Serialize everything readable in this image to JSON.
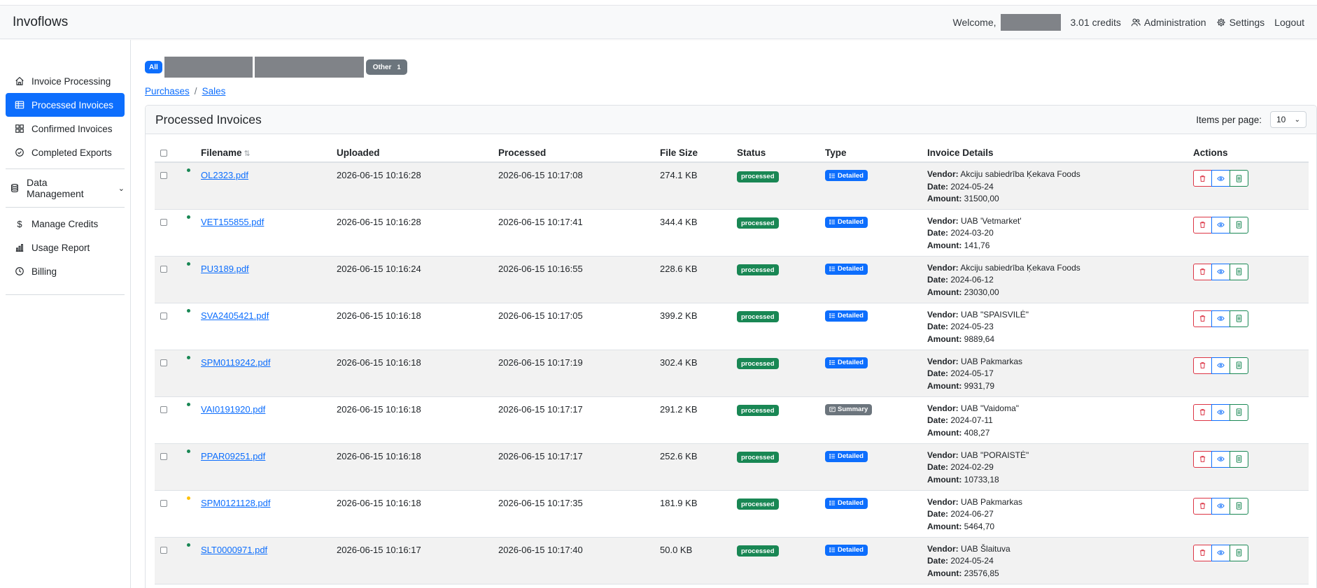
{
  "app": {
    "title": "Invoflows"
  },
  "header": {
    "welcome": "Welcome,",
    "credits": "3.01 credits",
    "administration": "Administration",
    "settings": "Settings",
    "logout": "Logout"
  },
  "sidebar": {
    "items": [
      {
        "label": "Invoice Processing",
        "icon": "home-icon",
        "active": false
      },
      {
        "label": "Processed Invoices",
        "icon": "table-icon",
        "active": true
      },
      {
        "label": "Confirmed Invoices",
        "icon": "grid-icon",
        "active": false
      },
      {
        "label": "Completed Exports",
        "icon": "check-circle-icon",
        "active": false
      }
    ],
    "data_management": "Data Management",
    "bottom_items": [
      {
        "label": "Manage Credits",
        "icon": "dollar-icon"
      },
      {
        "label": "Usage Report",
        "icon": "bar-chart-icon"
      },
      {
        "label": "Billing",
        "icon": "clock-icon"
      }
    ]
  },
  "filters": {
    "all": "All",
    "other": "Other",
    "other_count": "1"
  },
  "breadcrumb": {
    "purchases": "Purchases",
    "separator": "/",
    "sales": "Sales"
  },
  "card": {
    "title": "Processed Invoices",
    "items_per_page_label": "Items per page:",
    "items_per_page_value": "10"
  },
  "table": {
    "columns": [
      "Filename",
      "Uploaded",
      "Processed",
      "File Size",
      "Status",
      "Type",
      "Invoice Details",
      "Actions"
    ],
    "details_labels": {
      "vendor": "Vendor:",
      "date": "Date:",
      "amount": "Amount:"
    },
    "rows": [
      {
        "filename": "OL2323.pdf",
        "uploaded": "2026-06-15 10:16:28",
        "processed": "2026-06-15 10:17:08",
        "size": "274.1 KB",
        "status": "processed",
        "type": "Detailed",
        "dot": "ok",
        "vendor": "Akciju sabiedrība Ķekava Foods",
        "date": "2024-05-24",
        "amount": "31500,00"
      },
      {
        "filename": "VET155855.pdf",
        "uploaded": "2026-06-15 10:16:28",
        "processed": "2026-06-15 10:17:41",
        "size": "344.4 KB",
        "status": "processed",
        "type": "Detailed",
        "dot": "ok",
        "vendor": "UAB 'Vetmarket'",
        "date": "2024-03-20",
        "amount": "141,76"
      },
      {
        "filename": "PU3189.pdf",
        "uploaded": "2026-06-15 10:16:24",
        "processed": "2026-06-15 10:16:55",
        "size": "228.6 KB",
        "status": "processed",
        "type": "Detailed",
        "dot": "ok",
        "vendor": "Akciju sabiedrība Ķekava Foods",
        "date": "2024-06-12",
        "amount": "23030,00"
      },
      {
        "filename": "SVA2405421.pdf",
        "uploaded": "2026-06-15 10:16:18",
        "processed": "2026-06-15 10:17:05",
        "size": "399.2 KB",
        "status": "processed",
        "type": "Detailed",
        "dot": "ok",
        "vendor": "UAB \"SPAISVILĖ\"",
        "date": "2024-05-23",
        "amount": "9889,64"
      },
      {
        "filename": "SPM0119242.pdf",
        "uploaded": "2026-06-15 10:16:18",
        "processed": "2026-06-15 10:17:19",
        "size": "302.4 KB",
        "status": "processed",
        "type": "Detailed",
        "dot": "ok",
        "vendor": "UAB Pakmarkas",
        "date": "2024-05-17",
        "amount": "9931,79"
      },
      {
        "filename": "VAI0191920.pdf",
        "uploaded": "2026-06-15 10:16:18",
        "processed": "2026-06-15 10:17:17",
        "size": "291.2 KB",
        "status": "processed",
        "type": "Summary",
        "dot": "ok",
        "vendor": "UAB \"Vaidoma\"",
        "date": "2024-07-11",
        "amount": "408,27"
      },
      {
        "filename": "PPAR09251.pdf",
        "uploaded": "2026-06-15 10:16:18",
        "processed": "2026-06-15 10:17:17",
        "size": "252.6 KB",
        "status": "processed",
        "type": "Detailed",
        "dot": "ok",
        "vendor": "UAB \"PORAISTĖ\"",
        "date": "2024-02-29",
        "amount": "10733,18"
      },
      {
        "filename": "SPM0121128.pdf",
        "uploaded": "2026-06-15 10:16:18",
        "processed": "2026-06-15 10:17:35",
        "size": "181.9 KB",
        "status": "processed",
        "type": "Detailed",
        "dot": "warn",
        "vendor": "UAB Pakmarkas",
        "date": "2024-06-27",
        "amount": "5464,70"
      },
      {
        "filename": "SLT0000971.pdf",
        "uploaded": "2026-06-15 10:16:17",
        "processed": "2026-06-15 10:17:40",
        "size": "50.0 KB",
        "status": "processed",
        "type": "Detailed",
        "dot": "ok",
        "vendor": "UAB Šlaituva",
        "date": "2024-05-24",
        "amount": "23576,85"
      }
    ]
  },
  "colors": {
    "primary": "#0d6efd",
    "success": "#198754",
    "danger": "#dc3545",
    "secondary": "#6c757d",
    "warning": "#ffc107"
  }
}
